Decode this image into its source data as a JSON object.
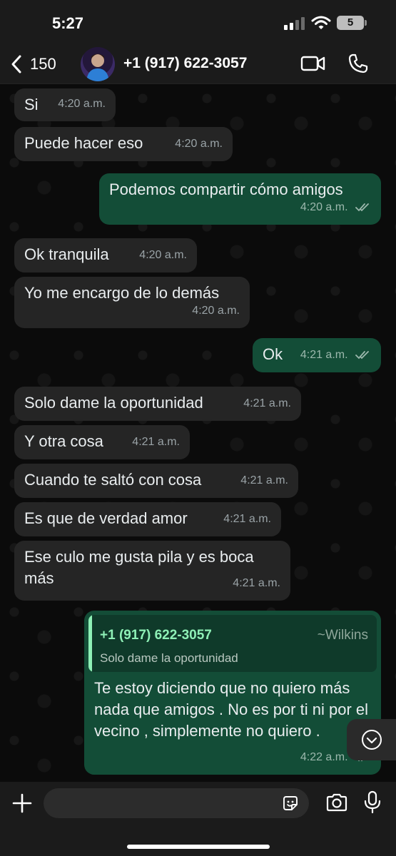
{
  "status_bar": {
    "time": "5:27",
    "battery": "5"
  },
  "header": {
    "back_count": "150",
    "contact_name": "+1 (917) 622-3057"
  },
  "messages": [
    {
      "dir": "in",
      "text": "Si",
      "time": "4:20 a.m."
    },
    {
      "dir": "in",
      "text": "Puede hacer eso",
      "time": "4:20 a.m."
    },
    {
      "dir": "out",
      "text": "Podemos compartir cómo amigos",
      "time": "4:20 a.m.",
      "status": "read"
    },
    {
      "dir": "in",
      "text": "Ok tranquila",
      "time": "4:20 a.m."
    },
    {
      "dir": "in",
      "text": "Yo me encargo de lo demás",
      "time": "4:20 a.m."
    },
    {
      "dir": "out",
      "text": "Ok",
      "time": "4:21 a.m.",
      "status": "read"
    },
    {
      "dir": "in",
      "text": "Solo dame la oportunidad",
      "time": "4:21 a.m."
    },
    {
      "dir": "in",
      "text": "Y otra cosa",
      "time": "4:21 a.m."
    },
    {
      "dir": "in",
      "text": "Cuando te saltó con cosa",
      "time": "4:21 a.m."
    },
    {
      "dir": "in",
      "text": "Es que de verdad amor",
      "time": "4:21 a.m."
    },
    {
      "dir": "in",
      "text": "Ese culo me gusta pila y es boca más",
      "time": "4:21 a.m."
    },
    {
      "dir": "out",
      "quote": {
        "name": "+1 (917) 622-3057",
        "alias": "~Wilkins",
        "text": "Solo dame la oportunidad"
      },
      "text": "Te estoy diciendo que no quiero más nada que amigos . No es por ti ni por el vecino , simplemente no quiero .",
      "time": "4:22 a.m.",
      "status": "read"
    }
  ],
  "composer": {
    "placeholder": ""
  },
  "icons": {
    "back": "chevron-left-icon",
    "video": "video-camera-icon",
    "call": "phone-icon",
    "plus": "plus-icon",
    "sticker": "sticker-icon",
    "camera": "camera-icon",
    "mic": "microphone-icon",
    "scroll": "chevron-down-icon",
    "ticks": "double-check-icon"
  },
  "colors": {
    "incoming_bubble": "#252525",
    "outgoing_bubble": "#134d37",
    "quote_accent": "#8ef0b6"
  }
}
